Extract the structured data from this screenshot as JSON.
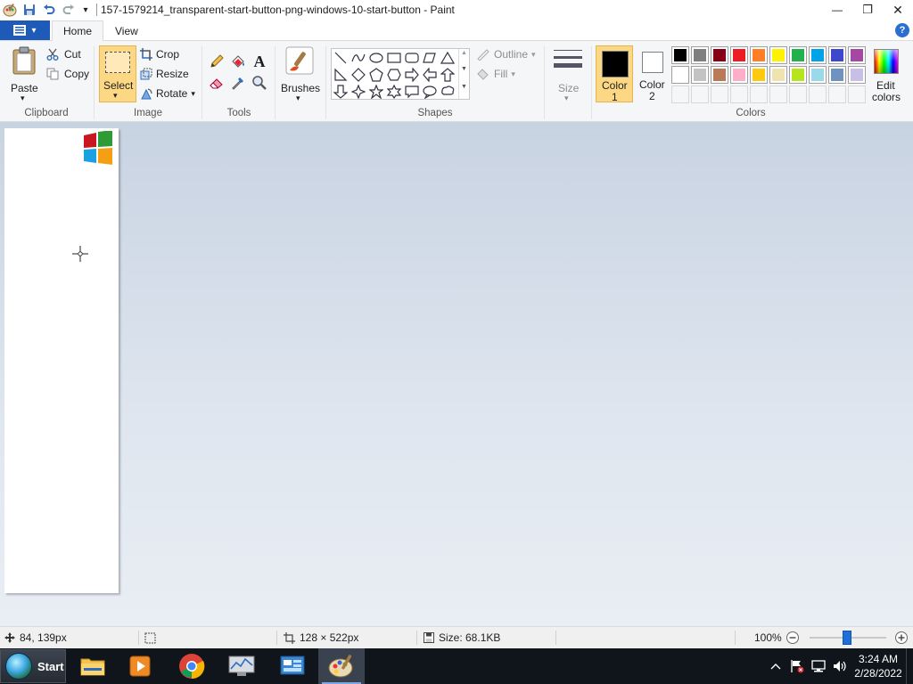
{
  "window": {
    "title": "157-1579214_transparent-start-button-png-windows-10-start-button - Paint",
    "controls": {
      "minimize": "—",
      "restore": "❐",
      "close": "✕"
    }
  },
  "quick_access": {
    "save_icon": "save-icon",
    "undo_icon": "undo-icon",
    "redo_icon": "redo-icon",
    "customize": "▾"
  },
  "tabs": {
    "file_caret": "▾",
    "home": "Home",
    "view": "View",
    "help": "?"
  },
  "ribbon": {
    "clipboard": {
      "group": "Clipboard",
      "paste": "Paste",
      "paste_caret": "▾",
      "cut": "Cut",
      "copy": "Copy"
    },
    "image": {
      "group": "Image",
      "select": "Select",
      "select_caret": "▾",
      "crop": "Crop",
      "resize": "Resize",
      "rotate": "Rotate",
      "rotate_caret": "▾"
    },
    "tools": {
      "group": "Tools",
      "text_tool": "A"
    },
    "brushes": {
      "label": "Brushes",
      "caret": "▾"
    },
    "shapes": {
      "group": "Shapes",
      "outline": "Outline",
      "fill": "Fill",
      "caret": "▾"
    },
    "size": {
      "label": "Size",
      "caret": "▾"
    },
    "colors": {
      "group": "Colors",
      "color1_line1": "Color",
      "color1_line2": "1",
      "color2_line1": "Color",
      "color2_line2": "2",
      "color1_value": "#000000",
      "color2_value": "#ffffff",
      "edit_line1": "Edit",
      "edit_line2": "colors",
      "palette_row1": [
        "#000000",
        "#7f7f7f",
        "#880015",
        "#ed1c24",
        "#ff7f27",
        "#fff200",
        "#22b14c",
        "#00a2e8",
        "#3f48cc",
        "#a349a4"
      ],
      "palette_row2": [
        "#ffffff",
        "#c3c3c3",
        "#b97a57",
        "#ffaec9",
        "#ffc90e",
        "#efe4b0",
        "#b5e61d",
        "#99d9ea",
        "#7092be",
        "#c8bfe7"
      ]
    }
  },
  "status": {
    "cursor_pos": "84, 139px",
    "dimensions": "128 × 522px",
    "file_size": "Size: 68.1KB",
    "zoom": "100%",
    "zoom_level": 1.0
  },
  "taskbar": {
    "start": "Start",
    "apps": [
      "file-explorer",
      "media-player",
      "chrome",
      "performance-monitor",
      "control-panel",
      "paint"
    ],
    "time": "3:24 AM",
    "date": "2/28/2022"
  }
}
